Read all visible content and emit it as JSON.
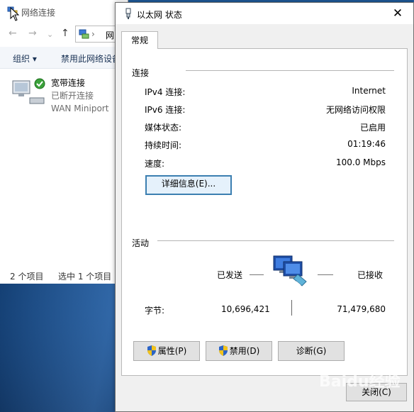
{
  "background_window": {
    "title": "网络连接",
    "address_text": "网",
    "toolbar": {
      "organize": "组织 ▾",
      "disable_device": "禁用此网络设备"
    },
    "connection": {
      "name": "宽带连接",
      "status": "已断开连接",
      "device": "WAN Miniport"
    },
    "statusbar": {
      "count": "2 个项目",
      "selected": "选中 1 个项目"
    }
  },
  "dialog": {
    "title": "以太网 状态",
    "close_glyph": "✕",
    "tab": "常规",
    "connection_section": {
      "title": "连接",
      "rows": [
        {
          "label": "IPv4 连接:",
          "value": "Internet"
        },
        {
          "label": "IPv6 连接:",
          "value": "无网络访问权限"
        },
        {
          "label": "媒体状态:",
          "value": "已启用"
        },
        {
          "label": "持续时间:",
          "value": "01:19:46"
        },
        {
          "label": "速度:",
          "value": "100.0 Mbps"
        }
      ],
      "details_button": "详细信息(E)..."
    },
    "activity_section": {
      "title": "活动",
      "sent_label": "已发送",
      "received_label": "已接收",
      "bytes_label": "字节:",
      "bytes_sent": "10,696,421",
      "bytes_received": "71,479,680"
    },
    "buttons": {
      "properties": "属性(P)",
      "disable": "禁用(D)",
      "diagnose": "诊断(G)",
      "close": "关闭(C)"
    }
  },
  "watermark": "Baidu经验",
  "colors": {
    "accent_focus": "#3c7fb1",
    "desktop": "#1e5a9a",
    "shield_blue": "#2b64c6",
    "shield_yellow": "#f2c21b"
  }
}
